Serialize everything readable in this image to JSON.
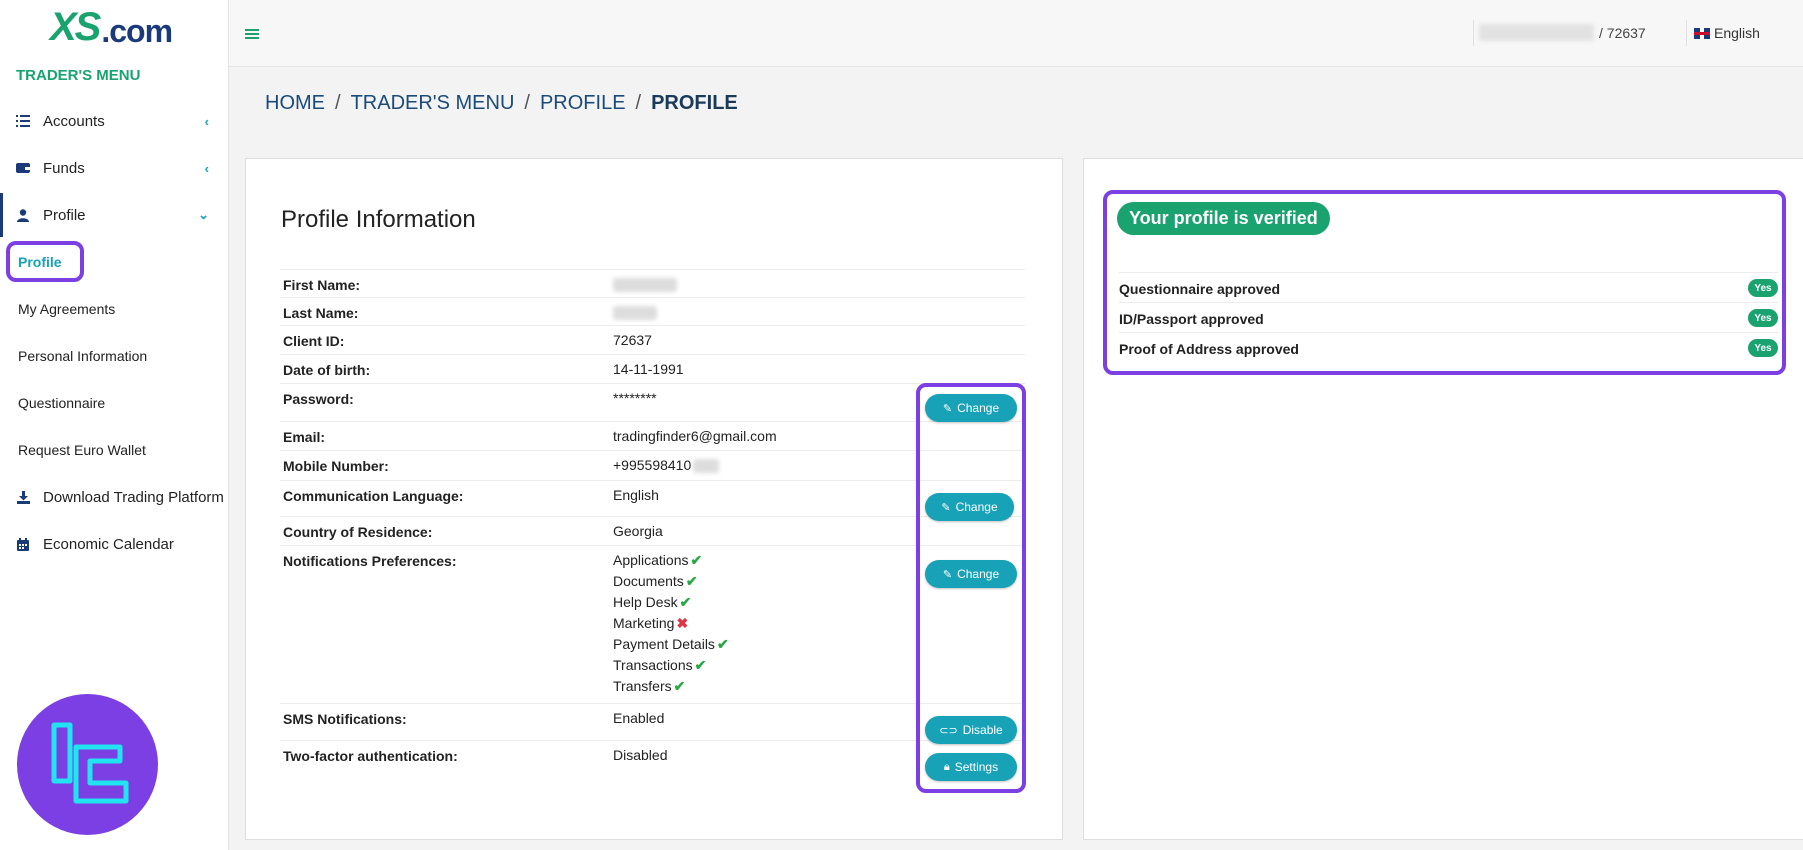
{
  "logo": {
    "brand": "XS",
    "suffix": ".com"
  },
  "sidebar": {
    "title": "TRADER'S MENU",
    "items": [
      {
        "label": "Accounts",
        "icon": "list-icon"
      },
      {
        "label": "Funds",
        "icon": "wallet-icon"
      },
      {
        "label": "Profile",
        "icon": "user-icon"
      }
    ],
    "sub_items": [
      "Profile",
      "My Agreements",
      "Personal Information",
      "Questionnaire",
      "Request Euro Wallet"
    ],
    "bottom_items": [
      {
        "label": "Download Trading Platform",
        "icon": "download-icon"
      },
      {
        "label": "Economic Calendar",
        "icon": "calendar-icon"
      }
    ]
  },
  "topbar": {
    "user_id": "/ 72637",
    "language": "English"
  },
  "breadcrumb": [
    "HOME",
    "TRADER'S MENU",
    "PROFILE",
    "PROFILE"
  ],
  "profile": {
    "title": "Profile Information",
    "fields": [
      {
        "label": "First Name:",
        "value": ""
      },
      {
        "label": "Last Name:",
        "value": ""
      },
      {
        "label": "Client ID:",
        "value": "72637"
      },
      {
        "label": "Date of birth:",
        "value": "14-11-1991"
      },
      {
        "label": "Password:",
        "value": "********"
      },
      {
        "label": "Email:",
        "value": "tradingfinder6@gmail.com"
      },
      {
        "label": "Mobile Number:",
        "value": "+995598410"
      },
      {
        "label": "Communication Language:",
        "value": "English"
      },
      {
        "label": "Country of Residence:",
        "value": "Georgia"
      },
      {
        "label": "Notifications Preferences:",
        "value": ""
      },
      {
        "label": "SMS Notifications:",
        "value": "Enabled"
      },
      {
        "label": "Two-factor authentication:",
        "value": "Disabled"
      }
    ],
    "notification_prefs": [
      {
        "label": "Applications",
        "enabled": true
      },
      {
        "label": "Documents",
        "enabled": true
      },
      {
        "label": "Help Desk",
        "enabled": true
      },
      {
        "label": "Marketing",
        "enabled": false
      },
      {
        "label": "Payment Details",
        "enabled": true
      },
      {
        "label": "Transactions",
        "enabled": true
      },
      {
        "label": "Transfers",
        "enabled": true
      }
    ],
    "buttons": {
      "change": "Change",
      "disable": "Disable",
      "settings": "Settings"
    }
  },
  "verification": {
    "badge": "Your profile is verified",
    "items": [
      {
        "label": "Questionnaire approved",
        "status": "Yes"
      },
      {
        "label": "ID/Passport approved",
        "status": "Yes"
      },
      {
        "label": "Proof of Address approved",
        "status": "Yes"
      }
    ]
  },
  "colors": {
    "accent": "#1aa36f",
    "button": "#17a2b8",
    "highlight": "#7b3fe4",
    "navy": "#1a3a7a"
  }
}
